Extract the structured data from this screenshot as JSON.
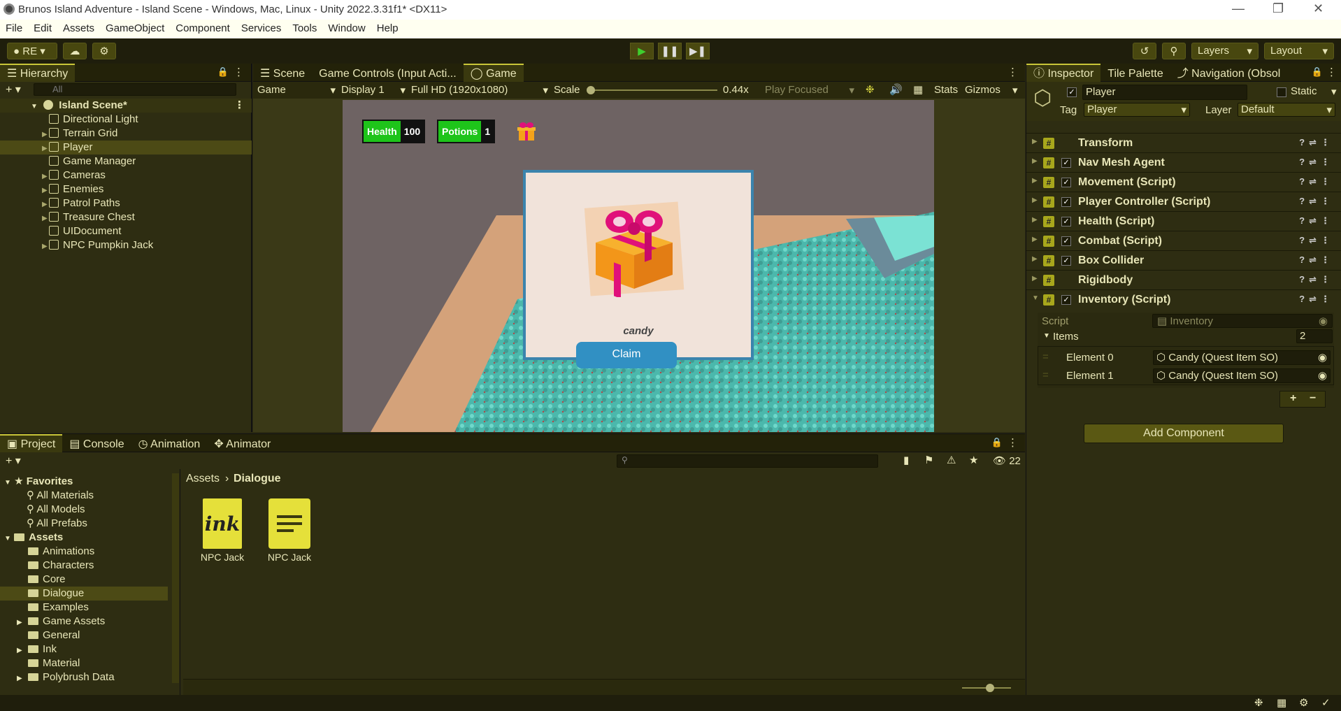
{
  "window": {
    "title": "Brunos Island Adventure - Island Scene - Windows, Mac, Linux - Unity 2022.3.31f1* <DX11>"
  },
  "menu": [
    "File",
    "Edit",
    "Assets",
    "GameObject",
    "Component",
    "Services",
    "Tools",
    "Window",
    "Help"
  ],
  "toolbar": {
    "account": "RE",
    "layers": "Layers",
    "layout": "Layout"
  },
  "hierarchy": {
    "tab": "Hierarchy",
    "search_placeholder": "All",
    "scene": "Island Scene*",
    "items": [
      {
        "label": "Directional Light",
        "expand": false
      },
      {
        "label": "Terrain Grid",
        "expand": true
      },
      {
        "label": "Player",
        "expand": true,
        "selected": true
      },
      {
        "label": "Game Manager",
        "expand": false
      },
      {
        "label": "Cameras",
        "expand": true
      },
      {
        "label": "Enemies",
        "expand": true
      },
      {
        "label": "Patrol Paths",
        "expand": true
      },
      {
        "label": "Treasure Chest",
        "expand": true
      },
      {
        "label": "UIDocument",
        "expand": false
      },
      {
        "label": "NPC Pumpkin Jack",
        "expand": true
      }
    ]
  },
  "center_tabs": [
    "Scene",
    "Game Controls (Input Acti...",
    "Game"
  ],
  "game_toolbar": {
    "view": "Game",
    "display": "Display 1",
    "resolution": "Full HD (1920x1080)",
    "scale_label": "Scale",
    "scale_value": "0.44x",
    "play_mode": "Play Focused",
    "stats": "Stats",
    "gizmos": "Gizmos"
  },
  "hud": {
    "health_label": "Health",
    "health_value": "100",
    "potions_label": "Potions",
    "potions_value": "1"
  },
  "reward_dialog": {
    "item_name": "candy",
    "claim": "Claim"
  },
  "inspector": {
    "tabs": [
      "Inspector",
      "Tile Palette",
      "Navigation (Obsol"
    ],
    "object_name": "Player",
    "static_label": "Static",
    "tag_label": "Tag",
    "tag_value": "Player",
    "layer_label": "Layer",
    "layer_value": "Default",
    "components": [
      {
        "name": "Transform",
        "checkbox": false
      },
      {
        "name": "Nav Mesh Agent",
        "checkbox": true
      },
      {
        "name": "Movement (Script)",
        "checkbox": true
      },
      {
        "name": "Player Controller (Script)",
        "checkbox": true
      },
      {
        "name": "Health (Script)",
        "checkbox": true
      },
      {
        "name": "Combat (Script)",
        "checkbox": true
      },
      {
        "name": "Box Collider",
        "checkbox": true
      },
      {
        "name": "Rigidbody",
        "checkbox": false
      },
      {
        "name": "Inventory (Script)",
        "checkbox": true
      }
    ],
    "inventory": {
      "script_label": "Script",
      "script_value": "Inventory",
      "items_label": "Items",
      "items_count": "2",
      "elements": [
        {
          "label": "Element 0",
          "value": "Candy (Quest Item SO)"
        },
        {
          "label": "Element 1",
          "value": "Candy (Quest Item SO)"
        }
      ]
    },
    "add_component": "Add Component"
  },
  "bottom_tabs": [
    "Project",
    "Console",
    "Animation",
    "Animator"
  ],
  "project": {
    "favorites_label": "Favorites",
    "favorites": [
      "All Materials",
      "All Models",
      "All Prefabs"
    ],
    "assets_label": "Assets",
    "folders": [
      {
        "label": "Animations",
        "expand": false
      },
      {
        "label": "Characters",
        "expand": false
      },
      {
        "label": "Core",
        "expand": false
      },
      {
        "label": "Dialogue",
        "expand": false,
        "selected": true
      },
      {
        "label": "Examples",
        "expand": false
      },
      {
        "label": "Game Assets",
        "expand": true
      },
      {
        "label": "General",
        "expand": false
      },
      {
        "label": "Ink",
        "expand": true
      },
      {
        "label": "Material",
        "expand": false
      },
      {
        "label": "Polybrush Data",
        "expand": true
      }
    ],
    "breadcrumb_root": "Assets",
    "breadcrumb_current": "Dialogue",
    "hidden_count": "22",
    "files": [
      {
        "label": "NPC Jack",
        "icon_text": "ink"
      },
      {
        "label": "NPC Jack",
        "icon_text": ""
      }
    ]
  }
}
